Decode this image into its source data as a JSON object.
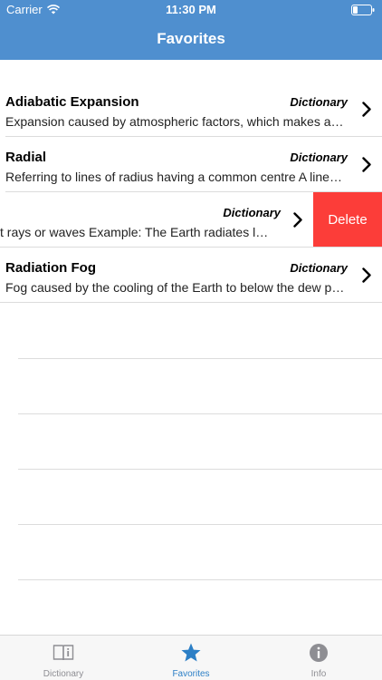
{
  "status_bar": {
    "carrier": "Carrier",
    "time": "11:30 PM"
  },
  "nav": {
    "title": "Favorites"
  },
  "rows": [
    {
      "title": "Adiabatic Expansion",
      "source": "Dictionary",
      "description": "Expansion caused by atmospheric factors, which makes a…"
    },
    {
      "title": "Radial",
      "source": "Dictionary",
      "description": "Referring to lines of radius having a common centre A line…"
    },
    {
      "title": "",
      "source": "Dictionary",
      "description": "t rays or waves Example: The Earth radiates lo…",
      "action": "Delete"
    },
    {
      "title": "Radiation Fog",
      "source": "Dictionary",
      "description": "Fog caused by the cooling of the Earth to below the dew p…"
    }
  ],
  "tabs": [
    {
      "label": "Dictionary",
      "icon": "book-icon",
      "active": false
    },
    {
      "label": "Favorites",
      "icon": "star-icon",
      "active": true
    },
    {
      "label": "Info",
      "icon": "info-icon",
      "active": false
    }
  ],
  "colors": {
    "header": "#4f8fcf",
    "delete": "#fc3d39",
    "tab_active": "#2c7fc6",
    "tab_inactive": "#8e8e93"
  }
}
